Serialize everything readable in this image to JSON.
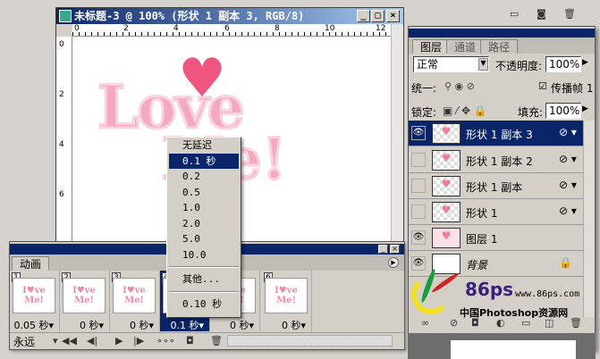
{
  "document": {
    "title": "未标题-3 @ 100% (形状 1 副本 3, RGB/8)",
    "ruler_top": [
      "0",
      "2",
      "4",
      "6",
      "8",
      "10",
      "12"
    ],
    "ruler_left": [
      "0",
      "2",
      "4",
      "6"
    ],
    "canvas_text": [
      "Love",
      "Me!"
    ]
  },
  "animation": {
    "tab": "动画",
    "frames": [
      {
        "num": "1",
        "delay": "0.05 秒▾"
      },
      {
        "num": "2",
        "delay": "0 秒▾"
      },
      {
        "num": "3",
        "delay": "0 秒▾"
      },
      {
        "num": "4",
        "delay": "0.1 秒▾"
      },
      {
        "num": "5",
        "delay": "0 秒▾"
      },
      {
        "num": "6",
        "delay": "0 秒▾"
      }
    ],
    "loop": "永远",
    "thumb": "I♥ve Me!"
  },
  "delay_menu": {
    "items": [
      "无延迟",
      "0.1 秒",
      "0.2",
      "0.5",
      "1.0",
      "2.0",
      "5.0",
      "10.0"
    ],
    "other": "其他...",
    "current": "0.10 秒"
  },
  "layers": {
    "tabs": [
      "图层",
      "通道",
      "路径"
    ],
    "blend_mode": "正常",
    "opacity_label": "不透明度:",
    "opacity": "100%",
    "unify_label": "统一:",
    "propagate_label": "传播帧 1",
    "lock_label": "锁定:",
    "fill_label": "填充:",
    "fill": "100%",
    "items": [
      {
        "name": "形状 1 副本 3",
        "visible": true
      },
      {
        "name": "形状 1 副本 2",
        "visible": false
      },
      {
        "name": "形状 1 副本",
        "visible": false
      },
      {
        "name": "形状 1",
        "visible": false
      },
      {
        "name": "图层 1",
        "visible": true
      },
      {
        "name": "背景",
        "visible": true
      }
    ]
  },
  "watermark": {
    "brand": "86ps",
    "url": "www.86ps.com",
    "tagline": "中国Photoshop资源网"
  }
}
